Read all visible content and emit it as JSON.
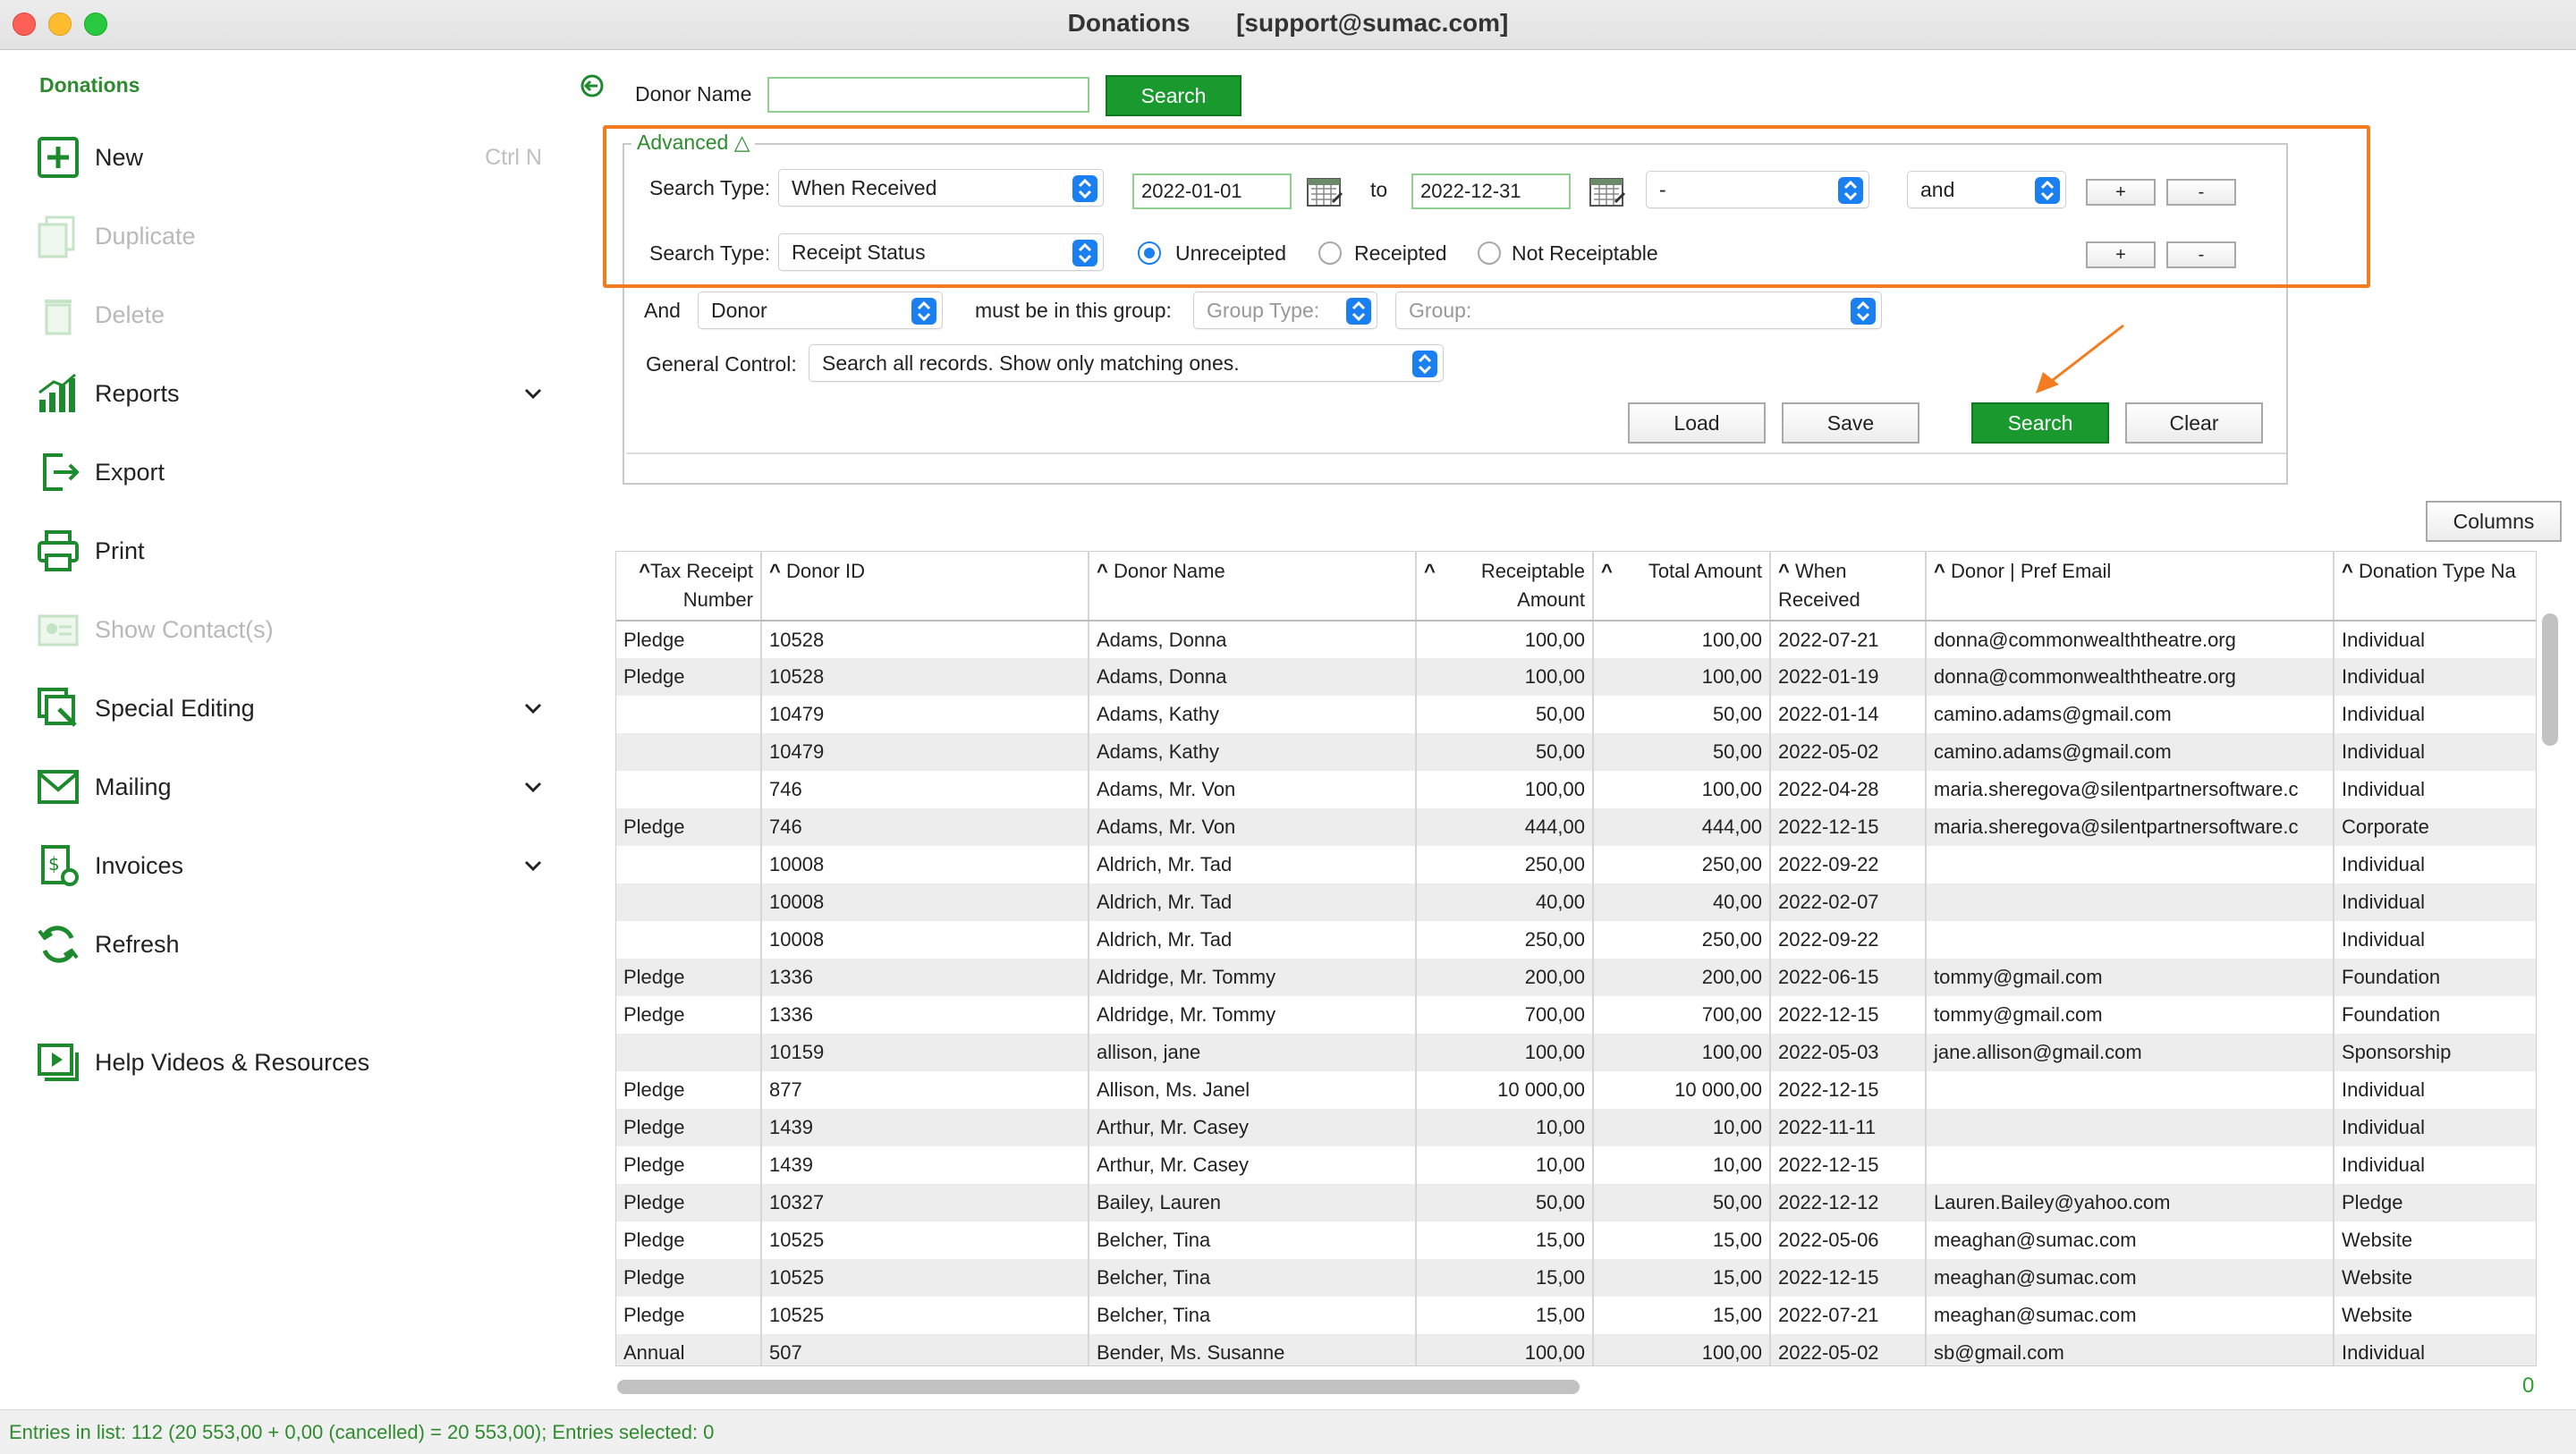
{
  "window": {
    "title": "Donations",
    "account": "[support@sumac.com]"
  },
  "sidebar": {
    "heading": "Donations",
    "items": [
      {
        "label": "New",
        "shortcut": "Ctrl N"
      },
      {
        "label": "Duplicate"
      },
      {
        "label": "Delete"
      },
      {
        "label": "Reports"
      },
      {
        "label": "Export"
      },
      {
        "label": "Print"
      },
      {
        "label": "Show Contact(s)"
      },
      {
        "label": "Special Editing"
      },
      {
        "label": "Mailing"
      },
      {
        "label": "Invoices"
      },
      {
        "label": "Refresh"
      },
      {
        "label": "Help Videos & Resources"
      }
    ]
  },
  "search_bar": {
    "donor_name_label": "Donor Name",
    "donor_name_value": "",
    "search_label": "Search"
  },
  "advanced": {
    "legend": "Advanced △",
    "row1": {
      "label": "Search Type:",
      "type": "When Received",
      "from": "2022-01-01",
      "to_label": "to",
      "to": "2022-12-31",
      "modifier": "-",
      "conjunction": "and",
      "plus": "+",
      "minus": "-"
    },
    "row2": {
      "label": "Search Type:",
      "type": "Receipt Status",
      "options": [
        "Unreceipted",
        "Receipted",
        "Not Receiptable"
      ],
      "selected": "Unreceipted",
      "plus": "+",
      "minus": "-"
    },
    "row3": {
      "and_label": "And",
      "entity": "Donor",
      "group_label": "must be in this group:",
      "group_type_placeholder": "Group Type:",
      "group_placeholder": "Group:"
    },
    "row4": {
      "label": "General Control:",
      "value": "Search all records. Show only matching ones."
    },
    "buttons": {
      "load": "Load",
      "save": "Save",
      "search": "Search",
      "clear": "Clear"
    }
  },
  "columns_button": "Columns",
  "table": {
    "headers": [
      {
        "line1": "Tax Receipt",
        "line2": "Number"
      },
      {
        "line1": "Donor ID",
        "line2": ""
      },
      {
        "line1": "Donor Name",
        "line2": ""
      },
      {
        "line1": "Receiptable",
        "line2": "Amount"
      },
      {
        "line1": "Total Amount",
        "line2": ""
      },
      {
        "line1": "When",
        "line2": "Received"
      },
      {
        "line1": "Donor | Pref Email",
        "line2": ""
      },
      {
        "line1": "Donation Type Na",
        "line2": ""
      }
    ],
    "rows": [
      [
        "Pledge",
        "10528",
        "Adams, Donna",
        "100,00",
        "100,00",
        "2022-07-21",
        "donna@commonwealththeatre.org",
        "Individual"
      ],
      [
        "Pledge",
        "10528",
        "Adams, Donna",
        "100,00",
        "100,00",
        "2022-01-19",
        "donna@commonwealththeatre.org",
        "Individual"
      ],
      [
        "",
        "10479",
        "Adams, Kathy",
        "50,00",
        "50,00",
        "2022-01-14",
        "camino.adams@gmail.com",
        "Individual"
      ],
      [
        "",
        "10479",
        "Adams, Kathy",
        "50,00",
        "50,00",
        "2022-05-02",
        "camino.adams@gmail.com",
        "Individual"
      ],
      [
        "",
        "746",
        "Adams, Mr. Von",
        "100,00",
        "100,00",
        "2022-04-28",
        "maria.sheregova@silentpartnersoftware.c",
        "Individual"
      ],
      [
        "Pledge",
        "746",
        "Adams, Mr. Von",
        "444,00",
        "444,00",
        "2022-12-15",
        "maria.sheregova@silentpartnersoftware.c",
        "Corporate"
      ],
      [
        "",
        "10008",
        "Aldrich, Mr. Tad",
        "250,00",
        "250,00",
        "2022-09-22",
        "",
        "Individual"
      ],
      [
        "",
        "10008",
        "Aldrich, Mr. Tad",
        "40,00",
        "40,00",
        "2022-02-07",
        "",
        "Individual"
      ],
      [
        "",
        "10008",
        "Aldrich, Mr. Tad",
        "250,00",
        "250,00",
        "2022-09-22",
        "",
        "Individual"
      ],
      [
        "Pledge",
        "1336",
        "Aldridge, Mr. Tommy",
        "200,00",
        "200,00",
        "2022-06-15",
        "tommy@gmail.com",
        "Foundation"
      ],
      [
        "Pledge",
        "1336",
        "Aldridge, Mr. Tommy",
        "700,00",
        "700,00",
        "2022-12-15",
        "tommy@gmail.com",
        "Foundation"
      ],
      [
        "",
        "10159",
        "allison, jane",
        "100,00",
        "100,00",
        "2022-05-03",
        "jane.allison@gmail.com",
        "Sponsorship"
      ],
      [
        "Pledge",
        "877",
        "Allison, Ms. Janel",
        "10 000,00",
        "10 000,00",
        "2022-12-15",
        "",
        "Individual"
      ],
      [
        "Pledge",
        "1439",
        "Arthur, Mr. Casey",
        "10,00",
        "10,00",
        "2022-11-11",
        "",
        "Individual"
      ],
      [
        "Pledge",
        "1439",
        "Arthur, Mr. Casey",
        "10,00",
        "10,00",
        "2022-12-15",
        "",
        "Individual"
      ],
      [
        "Pledge",
        "10327",
        "Bailey, Lauren",
        "50,00",
        "50,00",
        "2022-12-12",
        "Lauren.Bailey@yahoo.com",
        "Pledge"
      ],
      [
        "Pledge",
        "10525",
        "Belcher, Tina",
        "15,00",
        "15,00",
        "2022-05-06",
        "meaghan@sumac.com",
        "Website"
      ],
      [
        "Pledge",
        "10525",
        "Belcher, Tina",
        "15,00",
        "15,00",
        "2022-12-15",
        "meaghan@sumac.com",
        "Website"
      ],
      [
        "Pledge",
        "10525",
        "Belcher, Tina",
        "15,00",
        "15,00",
        "2022-07-21",
        "meaghan@sumac.com",
        "Website"
      ],
      [
        "Annual",
        "507",
        "Bender, Ms. Susanne",
        "100,00",
        "100,00",
        "2022-05-02",
        "sb@gmail.com",
        "Individual"
      ]
    ]
  },
  "corner_indicator": "0",
  "status_text": "Entries in list: 112 (20 553,00 + 0,00 (cancelled) = 20 553,00); Entries selected: 0",
  "colors": {
    "accent_green": "#1a9a2e",
    "highlight_orange": "#f47c20",
    "select_blue": "#1a7ff0"
  }
}
